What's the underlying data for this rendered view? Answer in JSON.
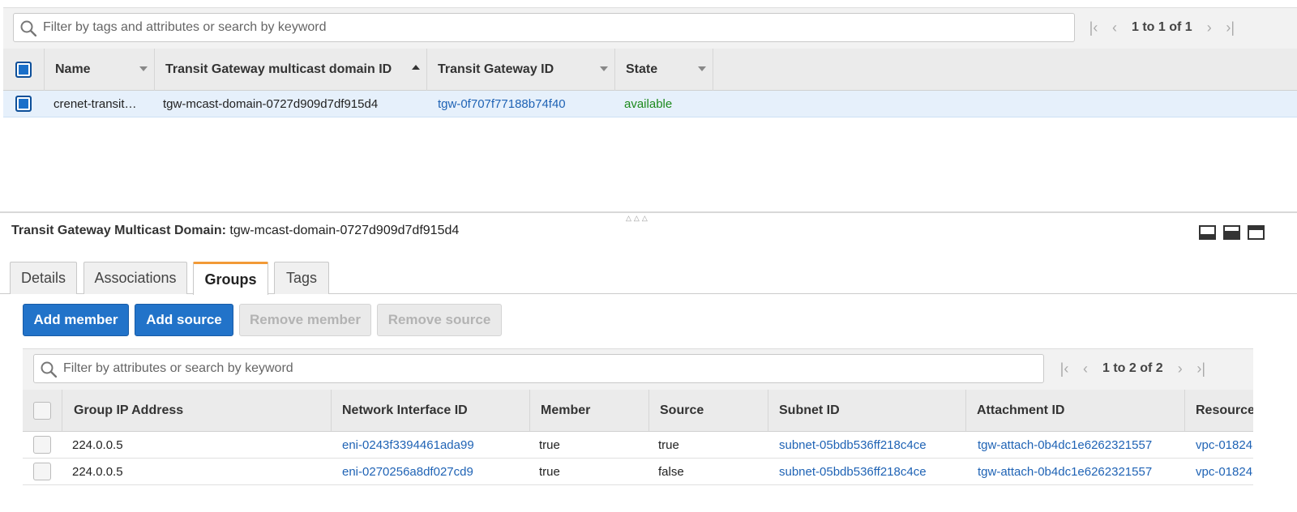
{
  "top_filter": {
    "placeholder": "Filter by tags and attributes or search by keyword",
    "pager_text": "1 to 1 of 1"
  },
  "top_table": {
    "columns": [
      "Name",
      "Transit Gateway multicast domain ID",
      "Transit Gateway ID",
      "State"
    ],
    "rows": [
      {
        "name": "crenet-transit…",
        "domain_id": "tgw-mcast-domain-0727d909d7df915d4",
        "tgw_id": "tgw-0f707f77188b74f40",
        "state": "available"
      }
    ]
  },
  "detail": {
    "label": "Transit Gateway Multicast Domain:",
    "value": "tgw-mcast-domain-0727d909d7df915d4"
  },
  "tabs": [
    "Details",
    "Associations",
    "Groups",
    "Tags"
  ],
  "active_tab": "Groups",
  "actions": {
    "add_member": "Add member",
    "add_source": "Add source",
    "remove_member": "Remove member",
    "remove_source": "Remove source"
  },
  "inner_filter": {
    "placeholder": "Filter by attributes or search by keyword",
    "pager_text": "1 to 2 of 2"
  },
  "groups_table": {
    "columns": [
      "Group IP Address",
      "Network Interface ID",
      "Member",
      "Source",
      "Subnet ID",
      "Attachment ID",
      "Resource"
    ],
    "rows": [
      {
        "group_ip": "224.0.0.5",
        "eni": "eni-0243f3394461ada99",
        "member": "true",
        "source": "true",
        "subnet": "subnet-05bdb536ff218c4ce",
        "attachment": "tgw-attach-0b4dc1e6262321557",
        "resource": "vpc-01824"
      },
      {
        "group_ip": "224.0.0.5",
        "eni": "eni-0270256a8df027cd9",
        "member": "true",
        "source": "false",
        "subnet": "subnet-05bdb536ff218c4ce",
        "attachment": "tgw-attach-0b4dc1e6262321557",
        "resource": "vpc-01824"
      }
    ]
  },
  "colors": {
    "primary": "#2273c9",
    "link": "#1f63b5",
    "available": "#1d8a1d",
    "tab_accent": "#f29a37"
  }
}
